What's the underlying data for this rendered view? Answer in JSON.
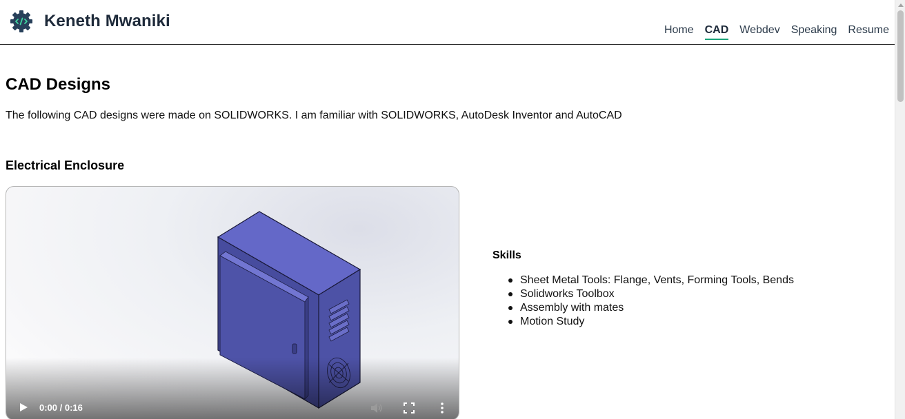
{
  "header": {
    "brand": "Keneth Mwaniki",
    "logo_icon": "code-gear-icon",
    "nav": [
      {
        "label": "Home",
        "active": false
      },
      {
        "label": "CAD",
        "active": true
      },
      {
        "label": "Webdev",
        "active": false
      },
      {
        "label": "Speaking",
        "active": false
      },
      {
        "label": "Resume",
        "active": false
      }
    ]
  },
  "main": {
    "title": "CAD Designs",
    "intro": "The following CAD designs were made on SOLIDWORKS. I am familiar with SOLIDWORKS, AutoDesk Inventor and AutoCAD",
    "sections": [
      {
        "title": "Electrical Enclosure",
        "video": {
          "time": "0:00 / 0:16",
          "controls": [
            "play-icon",
            "mute-icon",
            "fullscreen-icon",
            "more-icon"
          ]
        },
        "skills_title": "Skills",
        "skills": [
          "Sheet Metal Tools: Flange, Vents, Forming Tools, Bends",
          "Solidworks Toolbox",
          "Assembly with mates",
          "Motion Study"
        ]
      }
    ]
  },
  "colors": {
    "brand_text": "#1e2a3a",
    "active_underline": "#1aa37a",
    "enclosure_front": "#4a4fa0",
    "enclosure_top": "#6468c8"
  }
}
